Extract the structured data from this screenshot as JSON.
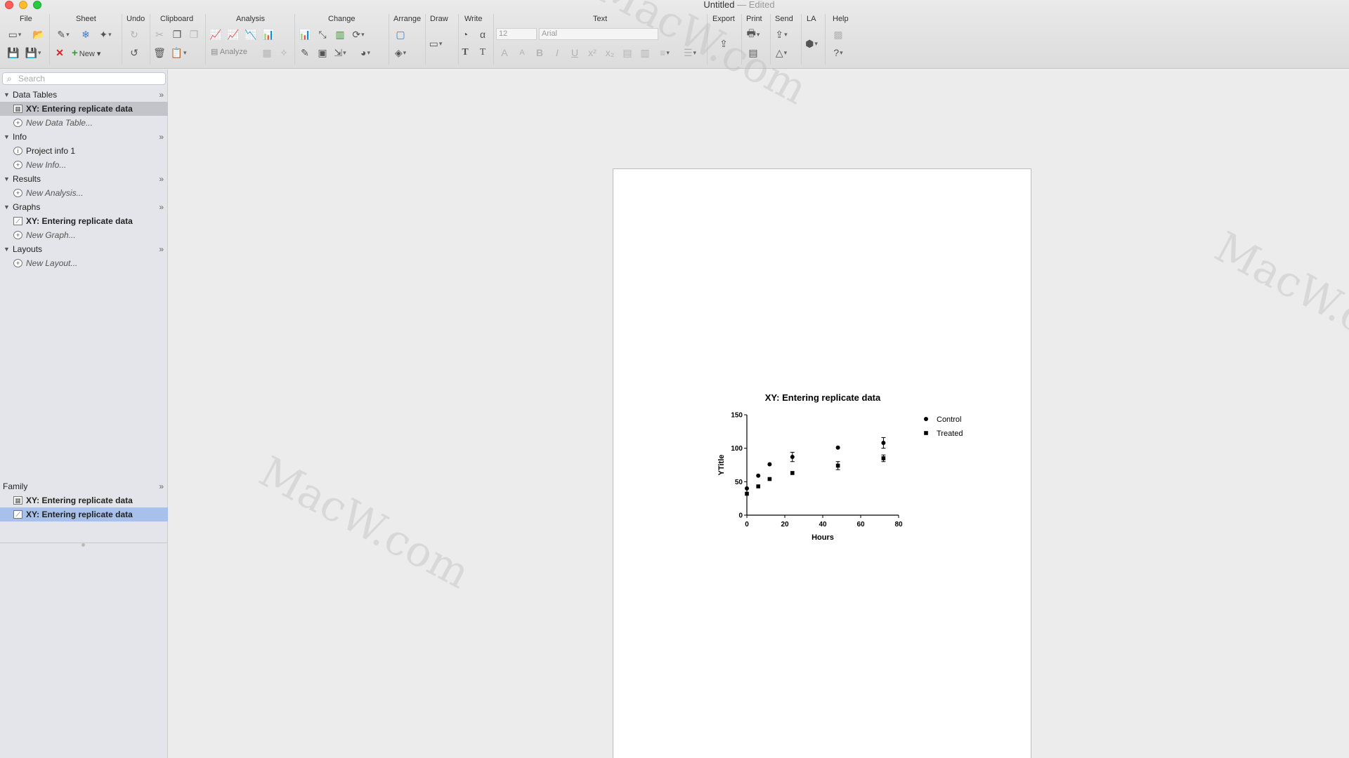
{
  "window": {
    "title": "Untitled",
    "edited": "— Edited"
  },
  "toolbar": {
    "groups": {
      "file": "File",
      "sheet": "Sheet",
      "undo": "Undo",
      "clipboard": "Clipboard",
      "analysis": "Analysis",
      "change": "Change",
      "arrange": "Arrange",
      "draw": "Draw",
      "write": "Write",
      "text": "Text",
      "export": "Export",
      "print": "Print",
      "send": "Send",
      "la": "LA",
      "help": "Help"
    },
    "new_label": "New",
    "analyze_label": "Analyze",
    "font_size": "12",
    "font_name": "Arial"
  },
  "sidebar": {
    "search_placeholder": "Search",
    "sections": {
      "data_tables": "Data Tables",
      "info": "Info",
      "results": "Results",
      "graphs": "Graphs",
      "layouts": "Layouts",
      "family": "Family"
    },
    "items": {
      "data_table_1": "XY: Entering replicate data",
      "new_data_table": "New Data Table...",
      "project_info": "Project info 1",
      "new_info": "New Info...",
      "new_analysis": "New Analysis...",
      "graph_1": "XY: Entering replicate data",
      "new_graph": "New Graph...",
      "new_layout": "New Layout...",
      "family_table": "XY: Entering replicate data",
      "family_graph": "XY: Entering replicate data"
    }
  },
  "watermark_text": "MacW.com",
  "chart_data": {
    "type": "scatter",
    "title": "XY: Entering replicate data",
    "xlabel": "Hours",
    "ylabel": "YTitle",
    "xlim": [
      0,
      80
    ],
    "ylim": [
      0,
      150
    ],
    "xticks": [
      "0",
      "20",
      "40",
      "60",
      "80"
    ],
    "yticks": [
      "0",
      "50",
      "100",
      "150"
    ],
    "legend_position": "top-right",
    "series": [
      {
        "name": "Control",
        "marker": "circle",
        "x": [
          0,
          6,
          12,
          24,
          48,
          72
        ],
        "y": [
          40,
          59,
          76,
          87,
          101,
          108
        ],
        "err": [
          2,
          2,
          2,
          7,
          2,
          8
        ]
      },
      {
        "name": "Treated",
        "marker": "square",
        "x": [
          0,
          6,
          12,
          24,
          48,
          72
        ],
        "y": [
          32,
          43,
          54,
          63,
          74,
          85
        ],
        "err": [
          2,
          2,
          2,
          2,
          6,
          5
        ]
      }
    ]
  }
}
